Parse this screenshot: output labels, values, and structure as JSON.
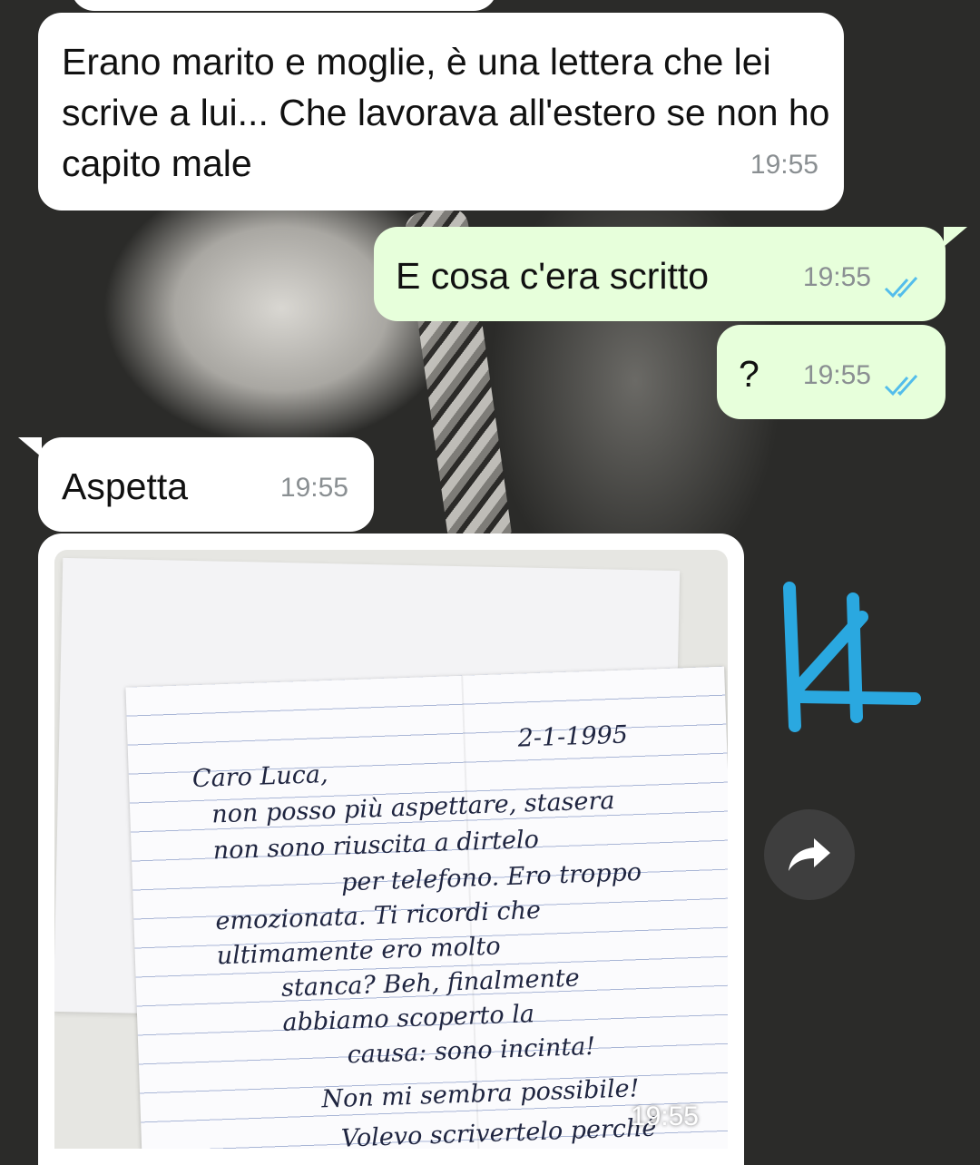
{
  "messages": [
    {
      "text": "Erano marito e moglie, è una lettera che lei scrive a lui... Che lavorava all'estero se non ho capito male",
      "time": "19:55"
    },
    {
      "text": "E cosa c'era scritto",
      "time": "19:55"
    },
    {
      "text": "?",
      "time": "19:55"
    },
    {
      "text": "Aspetta",
      "time": "19:55"
    }
  ],
  "image_message": {
    "time": "19:55",
    "letter": {
      "date": "2-1-1995",
      "lines": [
        "Caro Luca,",
        "non posso più aspettare, stasera",
        "non sono riuscita a dirtelo",
        "per telefono. Ero troppo",
        "emozionata. Ti ricordi che",
        "ultimamente ero molto",
        "stanca? Beh, finalmente",
        "abbiamo scoperto la",
        "causa: sono incinta!",
        "Non mi sembra possibile!",
        "Volevo scrivertelo perché"
      ]
    }
  },
  "share_icon": "share-forward-icon",
  "sticker": "K4",
  "colors": {
    "incoming": "#ffffff",
    "outgoing": "#e7ffdb",
    "read_ticks": "#53bdeb",
    "sticker": "#2aa8e0"
  }
}
